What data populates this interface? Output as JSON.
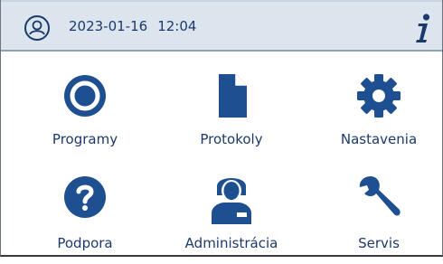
{
  "header": {
    "date": "2023-01-16",
    "time": "12:04",
    "user_icon": "user-circle-icon",
    "info_icon": "info-icon"
  },
  "menu": {
    "programs_label": "Programy",
    "protocols_label": "Protokoly",
    "settings_label": "Nastavenia",
    "support_label": "Podpora",
    "administration_label": "Administrácia",
    "service_label": "Servis"
  },
  "colors": {
    "accent": "#1d4f91",
    "header_bg": "#dce4ee",
    "text": "#1b3a6b"
  }
}
